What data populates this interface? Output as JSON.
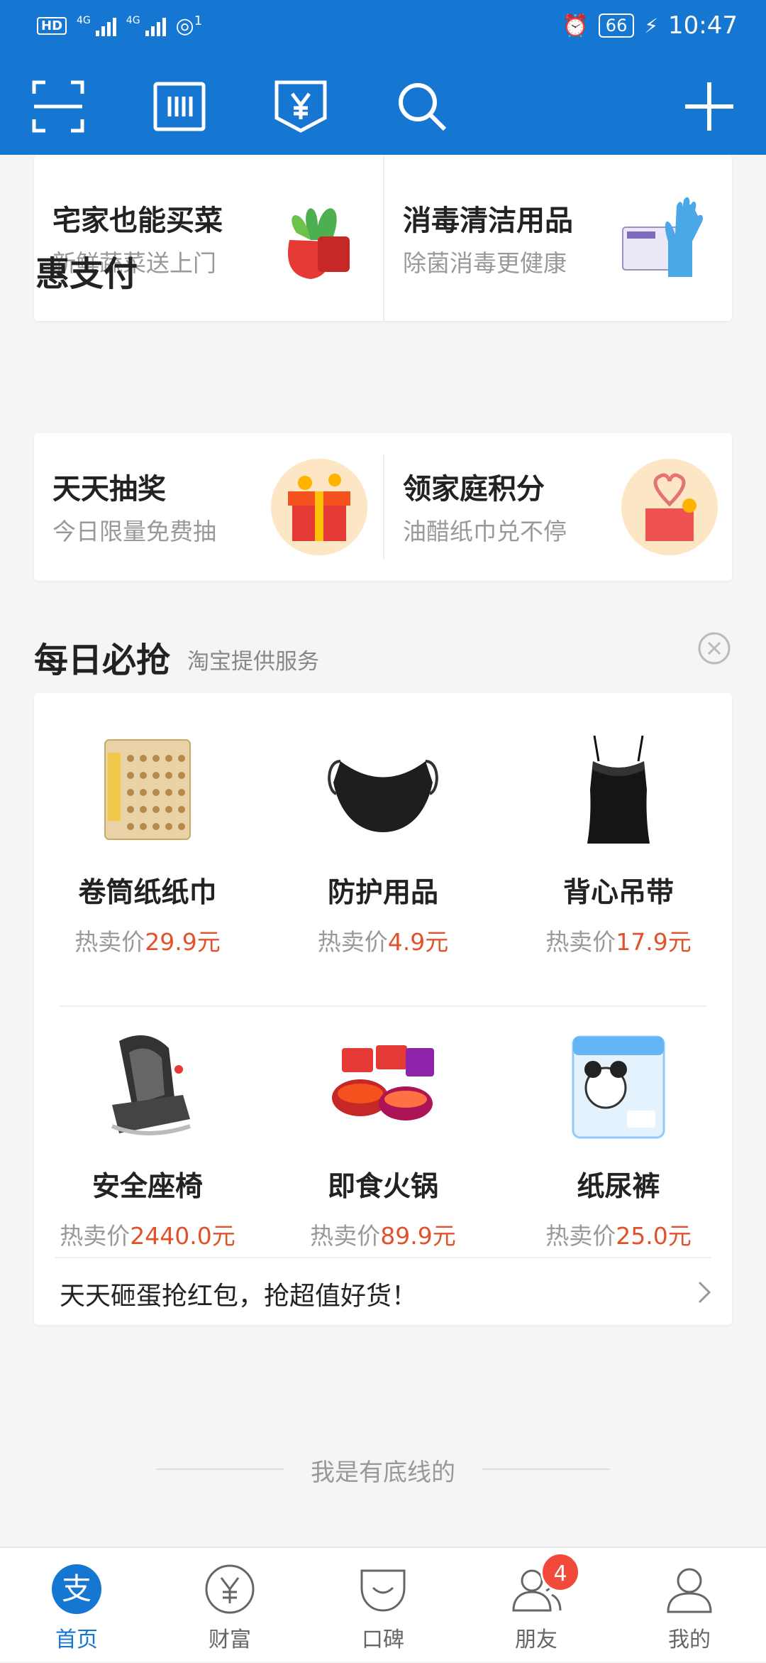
{
  "status_bar": {
    "left_badge": "HD",
    "net1": "4G",
    "net2": "4G",
    "hotspot_count": "1",
    "battery": "66",
    "time": "10:47"
  },
  "toolbar": {
    "icons": [
      "scan-icon",
      "payment-code-icon",
      "receive-money-icon",
      "search-icon",
      "add-icon"
    ]
  },
  "promo_top": [
    {
      "title": "宅家也能买菜",
      "subtitle": "新鲜蔬菜送上门"
    },
    {
      "title": "消毒清洁用品",
      "subtitle": "除菌消毒更健康"
    }
  ],
  "hui_pay": {
    "section_title": "惠支付",
    "items": [
      {
        "title": "天天抽奖",
        "subtitle": "今日限量免费抽"
      },
      {
        "title": "领家庭积分",
        "subtitle": "油醋纸巾兑不停"
      }
    ]
  },
  "daily_deals": {
    "section_title": "每日必抢",
    "provider": "淘宝提供服务",
    "price_prefix": "热卖价",
    "products": [
      {
        "name": "卷筒纸纸巾",
        "price": "29.9元"
      },
      {
        "name": "防护用品",
        "price": "4.9元"
      },
      {
        "name": "背心吊带",
        "price": "17.9元"
      },
      {
        "name": "安全座椅",
        "price": "2440.0元"
      },
      {
        "name": "即食火锅",
        "price": "89.9元"
      },
      {
        "name": "纸尿裤",
        "price": "25.0元"
      }
    ],
    "footer_link": "天天砸蛋抢红包，抢超值好货！"
  },
  "bottom_line_text": "我是有底线的",
  "tabbar": {
    "tabs": [
      {
        "label": "首页",
        "icon": "alipay-logo-icon",
        "active": true
      },
      {
        "label": "财富",
        "icon": "wealth-icon"
      },
      {
        "label": "口碑",
        "icon": "koubei-icon"
      },
      {
        "label": "朋友",
        "icon": "friends-icon",
        "badge": "4"
      },
      {
        "label": "我的",
        "icon": "profile-icon"
      }
    ]
  },
  "colors": {
    "brand_blue": "#1677d2",
    "price_red": "#e2522a",
    "badge_red": "#f24a3a"
  }
}
